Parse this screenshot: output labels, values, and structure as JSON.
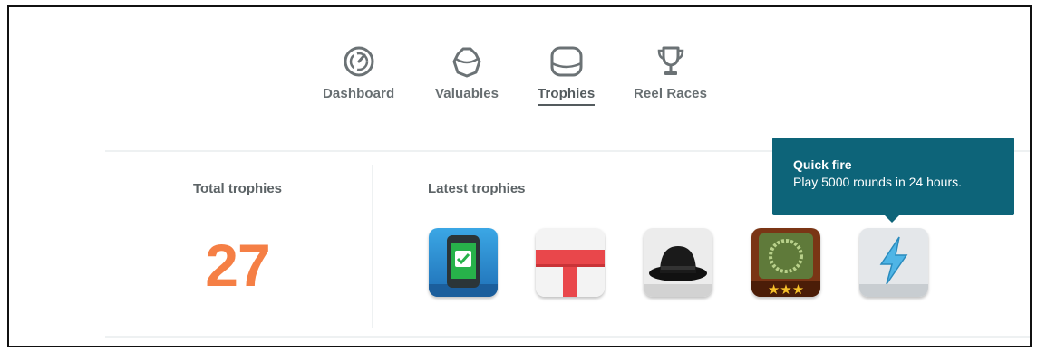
{
  "nav": {
    "items": [
      {
        "label": "Dashboard",
        "icon": "speedometer-icon"
      },
      {
        "label": "Valuables",
        "icon": "gem-icon"
      },
      {
        "label": "Trophies",
        "icon": "trophy-card-icon",
        "active": true
      },
      {
        "label": "Reel Races",
        "icon": "cup-icon"
      }
    ]
  },
  "summary": {
    "total_label": "Total trophies",
    "total_value": "27"
  },
  "latest": {
    "label": "Latest trophies",
    "items": [
      {
        "icon": "phone-check-icon"
      },
      {
        "icon": "gift-ribbon-icon"
      },
      {
        "icon": "bowler-hat-icon"
      },
      {
        "icon": "three-star-badge-icon"
      },
      {
        "icon": "lightning-bolt-icon"
      }
    ]
  },
  "tooltip": {
    "title": "Quick fire",
    "text": "Play 5000 rounds in 24 hours."
  },
  "colors": {
    "accent_orange": "#f57f45",
    "tooltip_bg": "#0d6479",
    "nav_text": "#676e71"
  }
}
